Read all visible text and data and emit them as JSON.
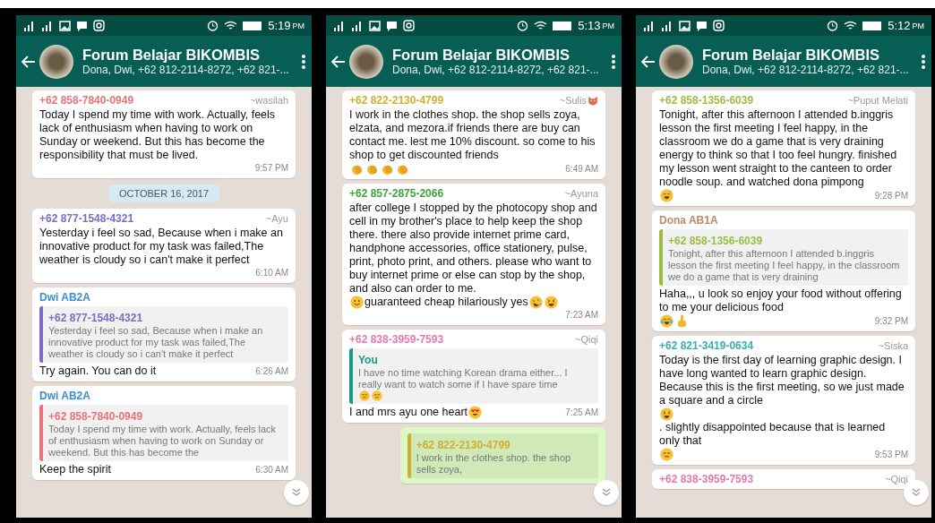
{
  "panels": [
    {
      "status_time": "5:19",
      "status_ampm": "PM",
      "title": "Forum Belajar BIKOMBIS",
      "subtitle": "Dona, Dwi, +62 812-2114-8272, +62 821-...",
      "messages": [
        {
          "kind": "incoming",
          "sender": "+62 858-7840-0949",
          "color": "#e8737a",
          "alias": "~wasilah",
          "body": [
            {
              "kind": "text",
              "text": "Today I spend my time with work. Actually, feels lack of enthusiasm when having to work on Sunday or weekend. But this has become the responsibility that must be lived."
            }
          ],
          "time": "9:57 PM"
        },
        {
          "kind": "date",
          "text": "OCTOBER 16, 2017"
        },
        {
          "kind": "incoming",
          "sender": "+62 877-1548-4321",
          "color": "#7c6cc4",
          "alias": "~Ayu",
          "body": [
            {
              "kind": "text",
              "text": "Yesterday i feel so sad, Because when i make an innovative product for my task was failed,The weather is cloudy so i can't make it perfect"
            }
          ],
          "time": "6:10 AM"
        },
        {
          "kind": "incoming",
          "sender": "Dwi AB2A",
          "color": "#3b8ed0",
          "quote": {
            "sender": "+62 877-1548-4321",
            "color": "#7c6cc4",
            "body": [
              {
                "kind": "text",
                "text": "Yesterday i feel so sad, Because when i make an innovative product for my task was failed,The weather is cloudy so i can't make it perfect"
              }
            ]
          },
          "body": [
            {
              "kind": "text",
              "text": "Try again.  You can do it"
            }
          ],
          "time": "6:26 AM"
        },
        {
          "kind": "incoming",
          "sender": "Dwi AB2A",
          "color": "#3b8ed0",
          "quote": {
            "sender": "+62 858-7840-0949",
            "color": "#e8737a",
            "body": [
              {
                "kind": "text",
                "text": "Today I spend my time with work. Actually, feels lack of enthusiasm when having to work on Sunday or weekend. But this has become the"
              }
            ]
          },
          "body": [
            {
              "kind": "text",
              "text": "Keep the spirit"
            }
          ],
          "time": "6:30 AM"
        }
      ]
    },
    {
      "status_time": "5:13",
      "status_ampm": "PM",
      "title": "Forum Belajar BIKOMBIS",
      "subtitle": "Dona, Dwi, +62 812-2114-8272, +62 821-...",
      "messages": [
        {
          "kind": "incoming",
          "sender": "+62 822-2130-4799",
          "color": "#cfb030",
          "alias": "~Sulis",
          "alias_emoji": true,
          "body": [
            {
              "kind": "text",
              "text": "I work in the clothes shop. the shop sells zoya, elzata, and mezora.if friends there are buy can contact me. lest me 10% discount. so come to his shop to get discounted friends"
            },
            {
              "kind": "clap"
            },
            {
              "kind": "clap"
            },
            {
              "kind": "clap"
            },
            {
              "kind": "clap"
            }
          ],
          "time": "6:49 AM"
        },
        {
          "kind": "incoming",
          "sender": "+62 857-2875-2066",
          "color": "#3aa63a",
          "alias": "~Ayuna",
          "body": [
            {
              "kind": "text",
              "text": "after college I stopped by the photocopy shop and cell in my brother's place to help keep the shop there. there also provide internet prime card, handphone accessories, office stationery, pulse, print, photo print, and others. please who want to buy internet prime or else can stop by the shop, and also can order to me."
            },
            {
              "kind": "smile"
            },
            {
              "kind": "text",
              "text": " guaranteed cheap hilariously yes"
            },
            {
              "kind": "rofl"
            },
            {
              "kind": "squint"
            }
          ],
          "time": "7:23 AM"
        },
        {
          "kind": "incoming",
          "sender": "+62 838-3959-7593",
          "color": "#e07ab0",
          "alias": "~Qiqi",
          "quote": {
            "sender": "You",
            "color": "#1a9a88",
            "body": [
              {
                "kind": "text",
                "text": "I have no time watching Korean drama either... I really want to watch some if I have spare time"
              },
              {
                "kind": "neutral"
              },
              {
                "kind": "neutral"
              }
            ]
          },
          "body": [
            {
              "kind": "text",
              "text": "I and mrs ayu one heart "
            },
            {
              "kind": "hearteyes"
            }
          ],
          "time": "7:25 AM"
        },
        {
          "kind": "outgoing",
          "quote": {
            "sender": "+62 822-2130-4799",
            "color": "#cfb030",
            "body": [
              {
                "kind": "text",
                "text": "I work in the clothes shop. the shop sells zoya,"
              }
            ]
          }
        }
      ]
    },
    {
      "status_time": "5:12",
      "status_ampm": "PM",
      "title": "Forum Belajar BIKOMBIS",
      "subtitle": "Dona, Dwi, +62 812-2114-8272, +62 821-...",
      "messages": [
        {
          "kind": "incoming",
          "sender": "+62 858-1356-6039",
          "color": "#9dbd42",
          "alias": "~Puput Melati",
          "body": [
            {
              "kind": "text",
              "text": "Tonight, after this afternoon I attended b.inggris lesson the first meeting I feel happy, in the classroom we do a game that is very draining energy to think so that I too feel hungry. finished my lesson went straight to the canteen to order noodle soup. and watched dona pimpong"
            },
            {
              "kind": "sweat"
            }
          ],
          "time": "9:28 PM"
        },
        {
          "kind": "incoming",
          "sender": "Dona AB1A",
          "color": "#b98b68",
          "quote": {
            "sender": "+62 858-1356-6039",
            "color": "#9dbd42",
            "body": [
              {
                "kind": "text",
                "text": "Tonight, after this afternoon I attended b.inggris lesson the first meeting I feel happy, in the classroom we do a game that is very draining"
              }
            ]
          },
          "body": [
            {
              "kind": "text",
              "text": "Haha,,, u look so enjoy your food without offering to me your delicious food "
            },
            {
              "kind": "tears"
            },
            {
              "kind": "point"
            }
          ],
          "time": "9:32 PM"
        },
        {
          "kind": "incoming",
          "sender": "+62 821-3419-0634",
          "color": "#3aaeb0",
          "alias": "~Siska",
          "body": [
            {
              "kind": "text",
              "text": "Today is the first day of learning graphic design. I have long wanted to learn graphic design. Because this is the first meeting, so we just made a square and a circle"
            },
            {
              "kind": "squint"
            },
            {
              "kind": "text",
              "text": ". slightly disappointed because that is learned only that "
            },
            {
              "kind": "neutral"
            }
          ],
          "time": "9:53 PM"
        },
        {
          "kind": "incoming",
          "sender": "+62 838-3959-7593",
          "color": "#e07ab0",
          "alias": "~Qiqi"
        }
      ]
    }
  ]
}
